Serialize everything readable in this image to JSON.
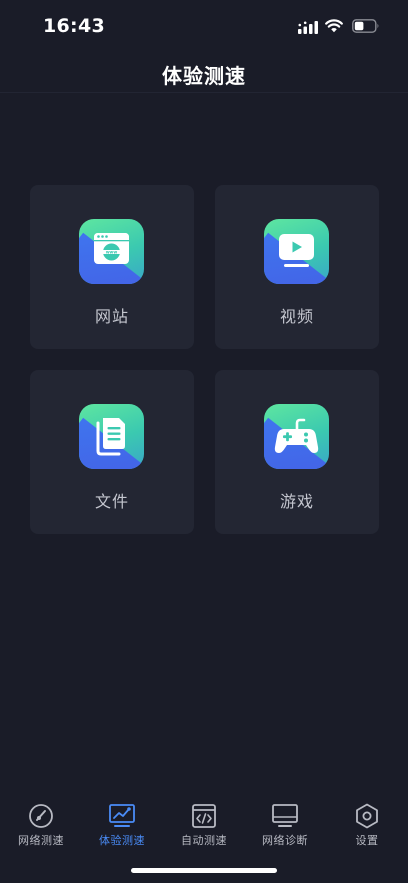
{
  "status_bar": {
    "time": "16:43",
    "battery_level": 0.45
  },
  "header": {
    "title": "体验测速"
  },
  "cards": [
    {
      "id": "website",
      "label": "网站",
      "icon": "browser-www-icon"
    },
    {
      "id": "video",
      "label": "视频",
      "icon": "video-play-icon"
    },
    {
      "id": "file",
      "label": "文件",
      "icon": "document-stack-icon"
    },
    {
      "id": "game",
      "label": "游戏",
      "icon": "gamepad-icon"
    }
  ],
  "tabs": [
    {
      "label": "网络测速",
      "icon": "speedometer-icon",
      "active": false
    },
    {
      "label": "体验测速",
      "icon": "chart-monitor-icon",
      "active": true
    },
    {
      "label": "自动测速",
      "icon": "code-window-icon",
      "active": false
    },
    {
      "label": "网络诊断",
      "icon": "monitor-icon",
      "active": false
    },
    {
      "label": "设置",
      "icon": "hexagon-settings-icon",
      "active": false
    }
  ],
  "colors": {
    "background": "#1a1c28",
    "card": "#232633",
    "active_tab": "#4a8cf7",
    "inactive_tab": "#b8bac3",
    "icon_gradient_green": "#5ee6a0",
    "icon_gradient_blue": "#3e6ff2"
  }
}
